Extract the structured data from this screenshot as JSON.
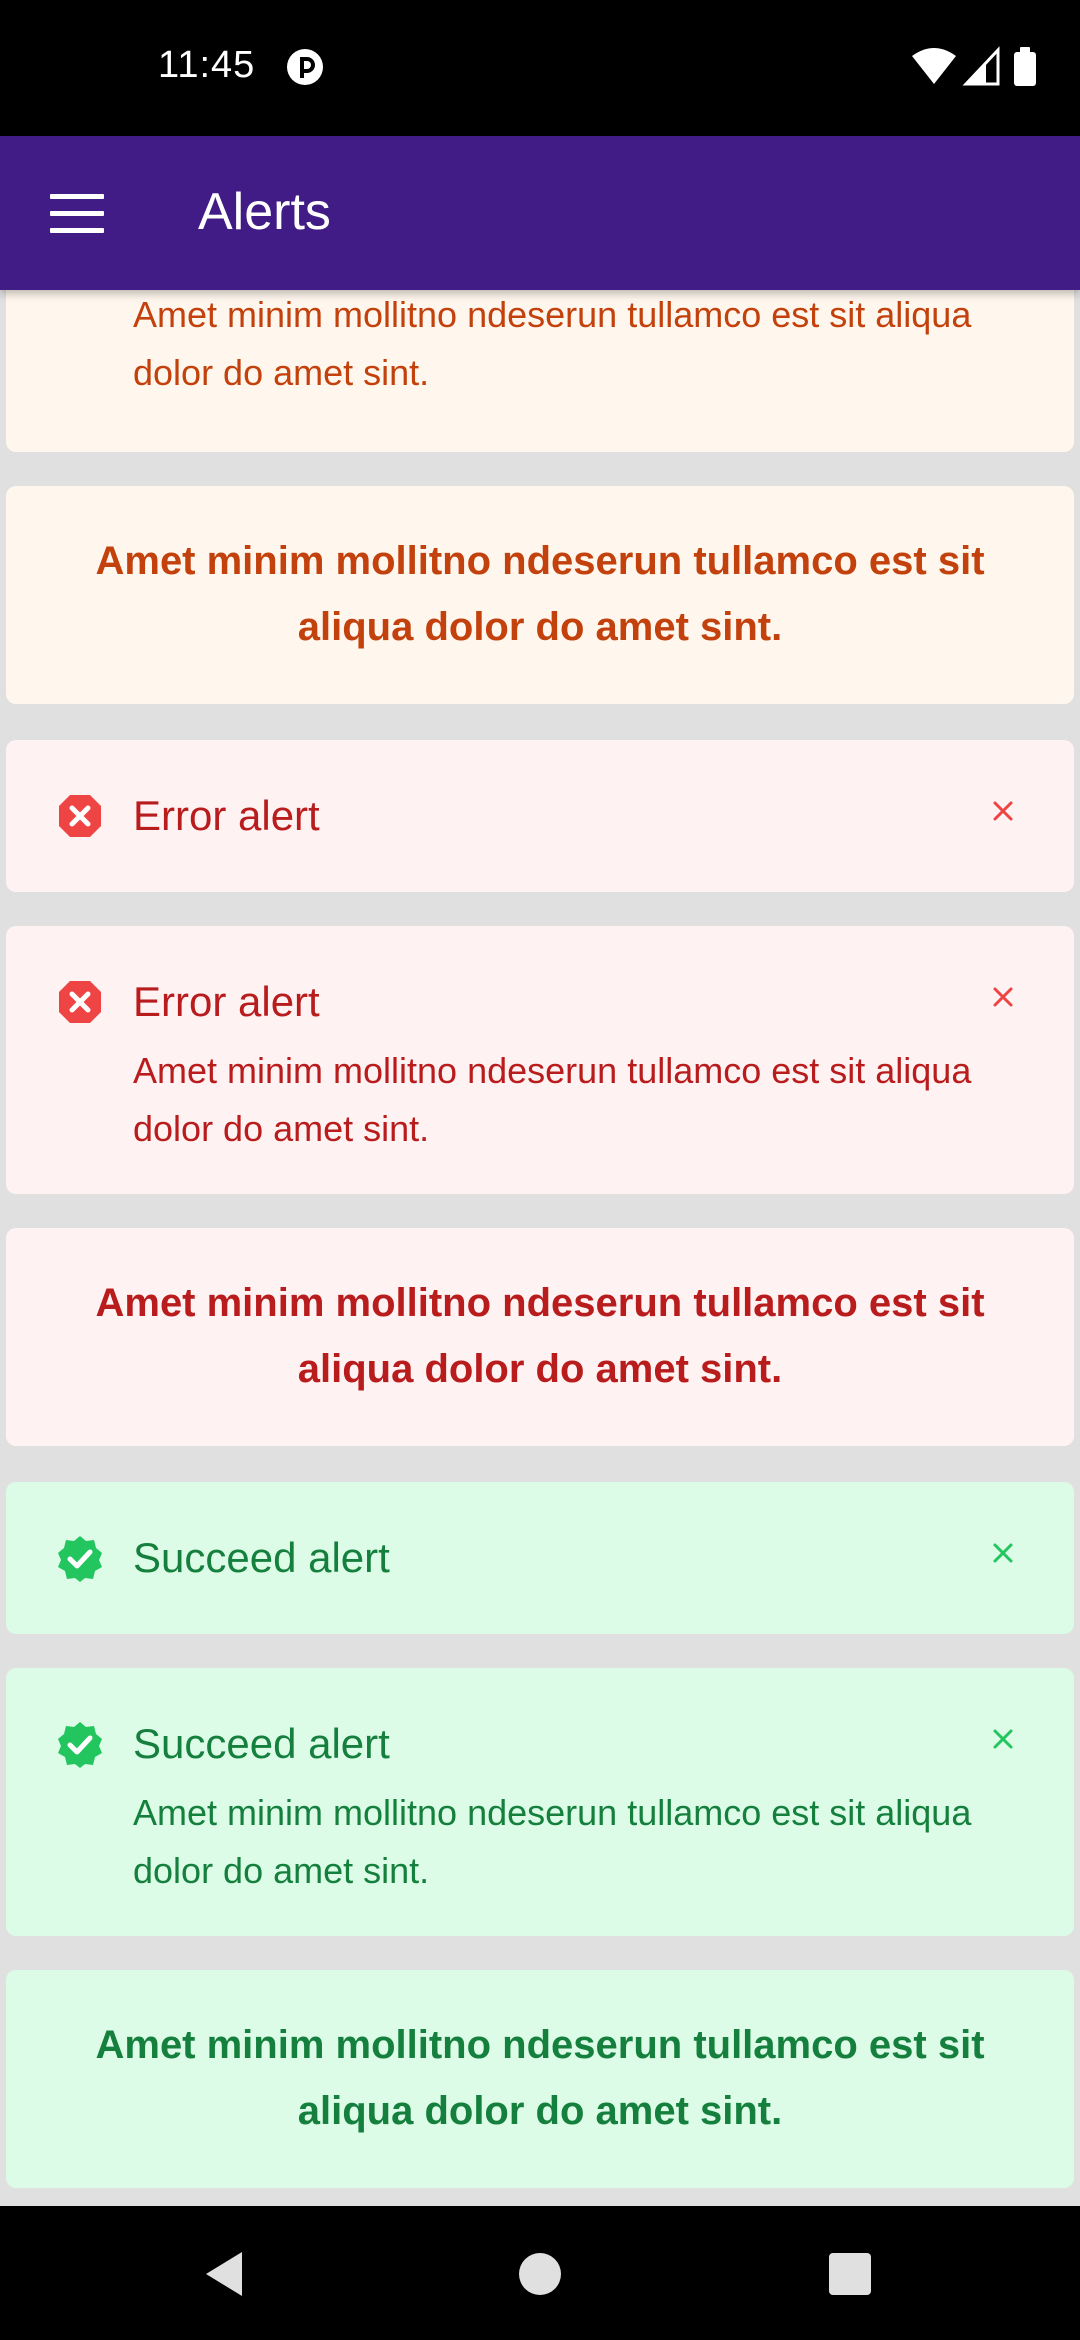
{
  "status_bar": {
    "time": "11:45"
  },
  "app_bar": {
    "title": "Alerts"
  },
  "alerts": {
    "warning_desc": "Amet minim mollitno ndeserun tullamco est sit aliqua dolor do amet sint.",
    "warning_center": "Amet minim mollitno ndeserun tullamco est sit aliqua dolor do amet sint.",
    "error_title_1": "Error alert",
    "error_title_2": "Error alert",
    "error_desc": "Amet minim mollitno ndeserun tullamco est sit aliqua dolor do amet sint.",
    "error_center": "Amet minim mollitno ndeserun tullamco est sit aliqua dolor do amet sint.",
    "success_title_1": "Succeed alert",
    "success_title_2": "Succeed alert",
    "success_desc": "Amet minim mollitno ndeserun tullamco est sit aliqua dolor do amet sint.",
    "success_center": "Amet minim mollitno ndeserun tullamco est sit aliqua dolor do amet sint."
  },
  "icons": {
    "error": "x-circle-icon",
    "success": "check-badge-icon",
    "close": "close-icon"
  },
  "colors": {
    "app_bar": "#421c86",
    "warning_bg": "#fff7ed",
    "warning_text": "#c2410c",
    "error_bg": "#fef2f2",
    "error_text": "#b91c1c",
    "error_icon": "#ef4444",
    "success_bg": "#dcfce7",
    "success_text": "#15803d",
    "success_icon": "#22c55e"
  }
}
